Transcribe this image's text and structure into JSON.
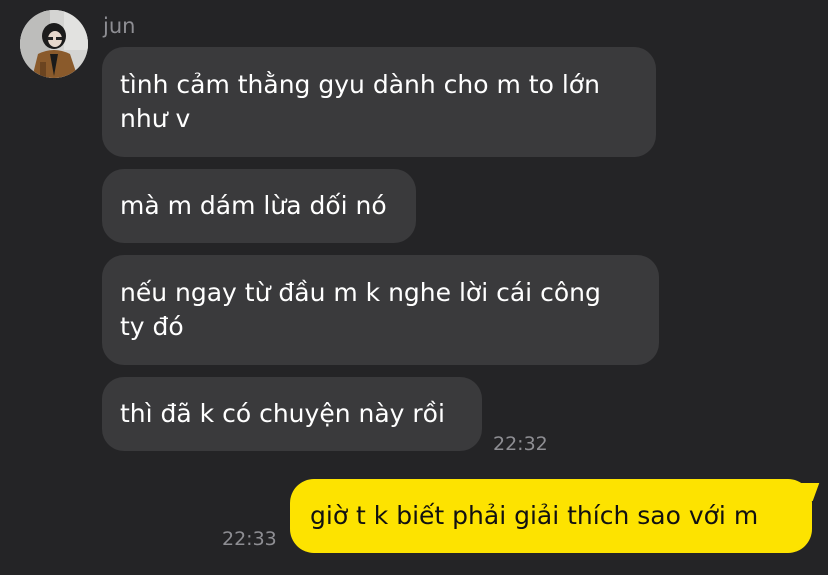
{
  "conversation": {
    "sender": {
      "name": "jun",
      "avatar_icon": "profile-photo"
    },
    "incoming_messages": [
      {
        "line1": "tình cảm thằng gyu dành cho m to lớn",
        "line2": "như v"
      },
      {
        "line1": "mà m dám lừa dối nó",
        "line2": ""
      },
      {
        "line1": "nếu ngay từ đầu m k nghe lời cái công",
        "line2": "ty đó"
      },
      {
        "line1": "thì đã k có chuyện này rồi",
        "line2": ""
      }
    ],
    "incoming_time": "22:32",
    "outgoing_message": "giờ t k biết phải giải thích sao với m",
    "outgoing_time": "22:33"
  },
  "colors": {
    "background": "#242426",
    "incoming_bubble": "#3a3a3c",
    "outgoing_bubble": "#fde300",
    "timestamp": "#8e8e93"
  }
}
